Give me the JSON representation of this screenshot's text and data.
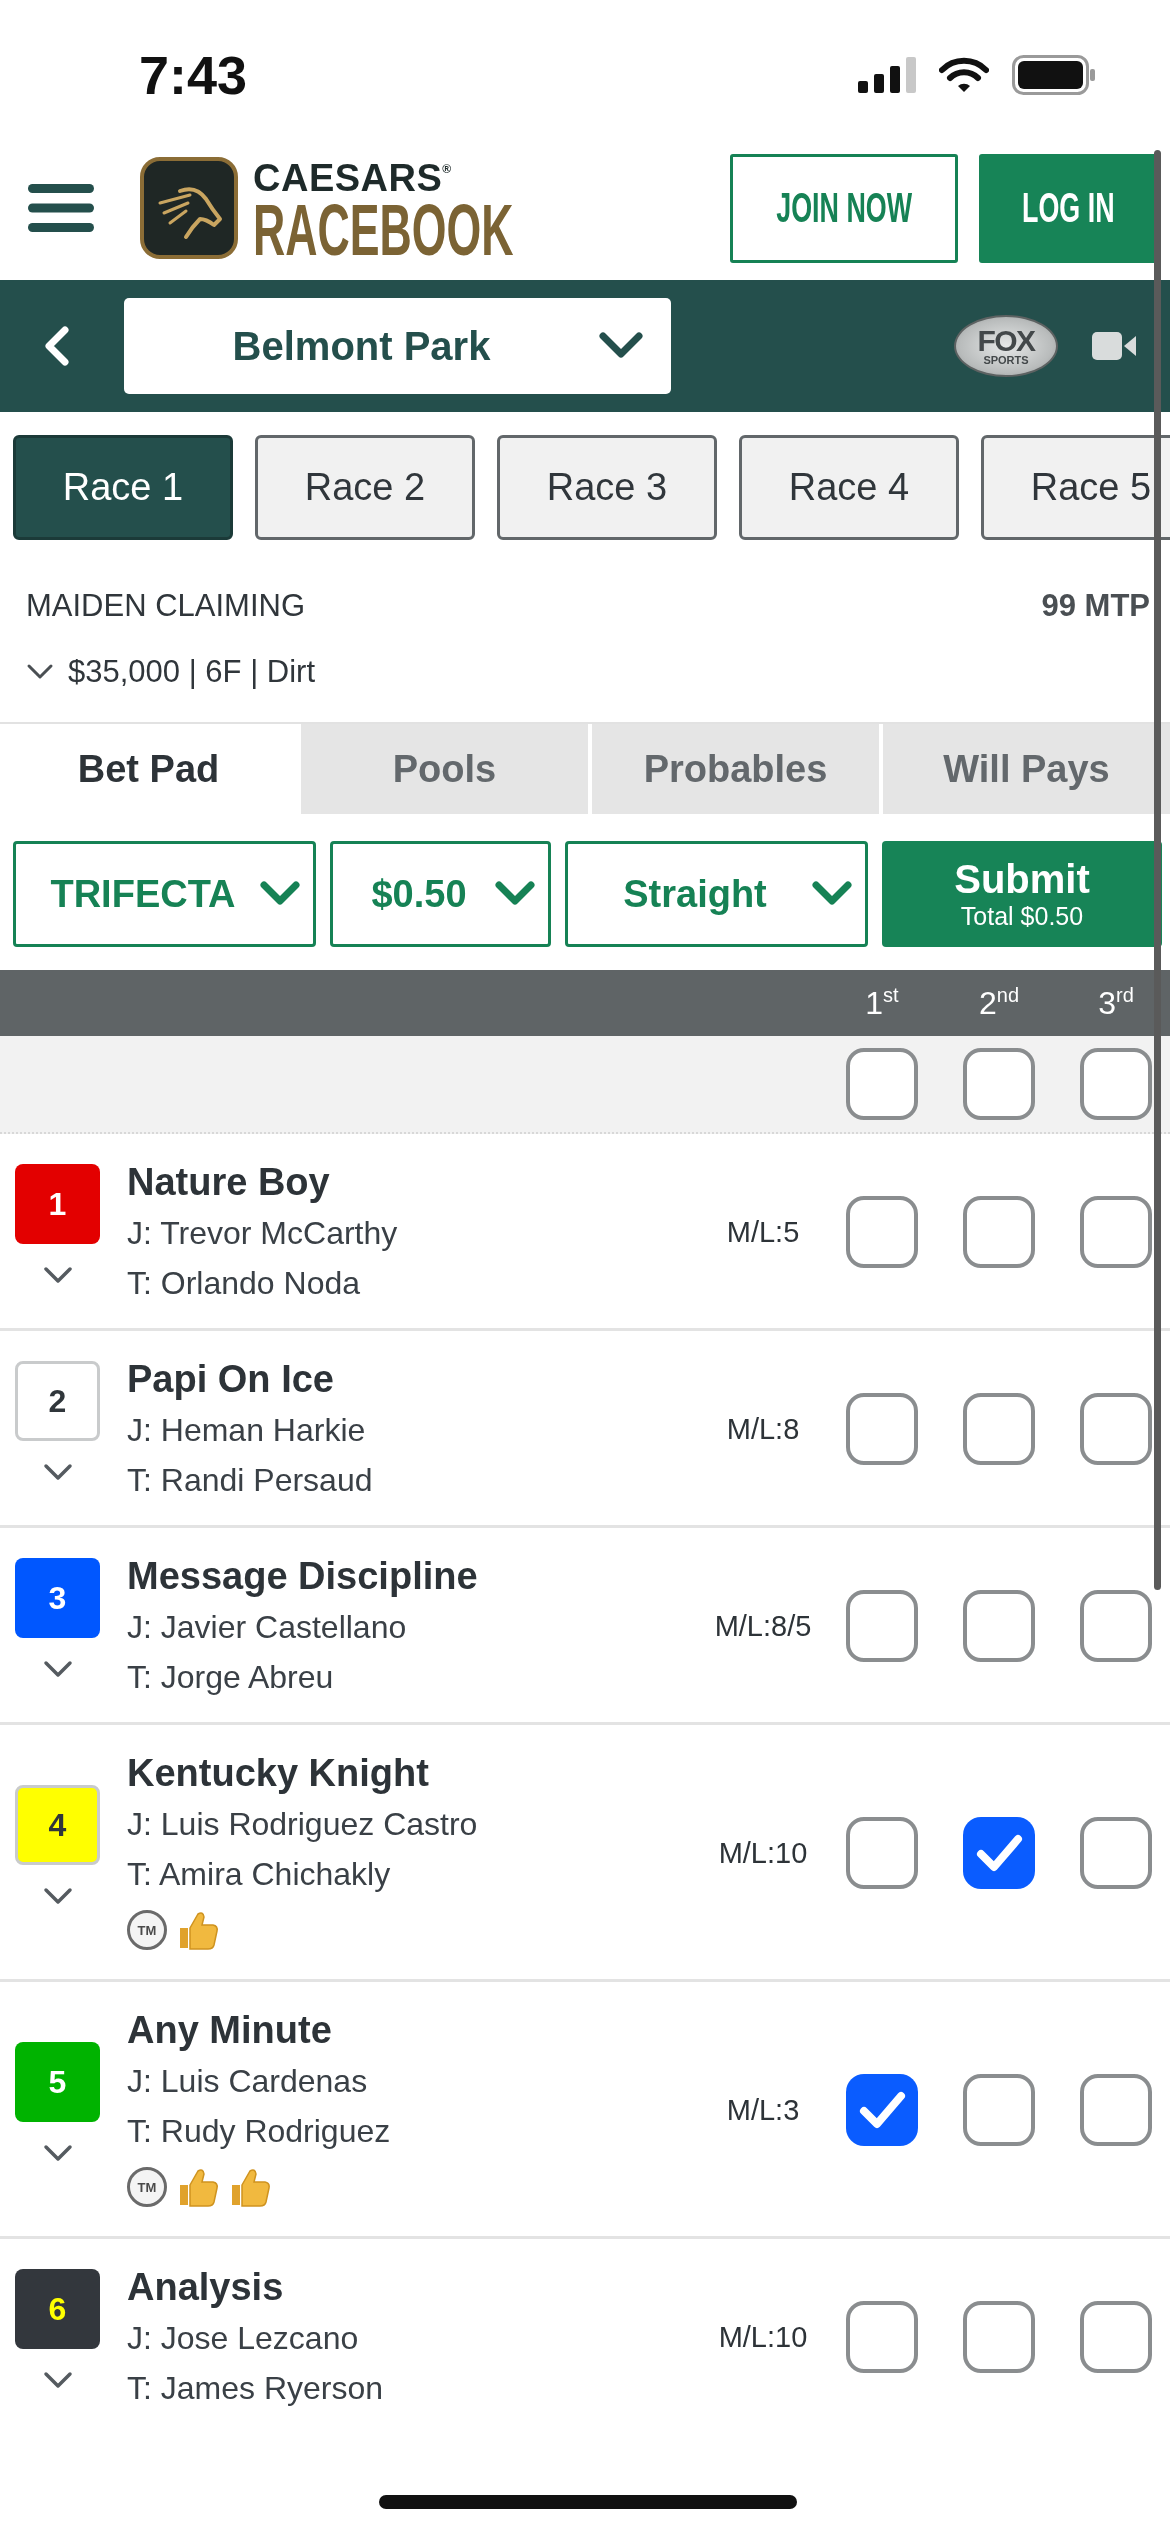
{
  "status_bar": {
    "time": "7:43"
  },
  "header": {
    "brand_top": "CAESARS$^{®}$",
    "brand_bottom": "RACEBOOK",
    "buttons": [
      {
        "label": "JOIN NOW",
        "kind": "outline"
      },
      {
        "label": "LOG IN",
        "kind": "filled"
      }
    ]
  },
  "track_bar": {
    "track": "Belmont Park",
    "channel_logo": {
      "top": "FOX",
      "bottom": "SPORTS"
    }
  },
  "race_tabs": [
    {
      "label": "Race 1",
      "selected": true
    },
    {
      "label": "Race 2",
      "selected": false
    },
    {
      "label": "Race 3",
      "selected": false
    },
    {
      "label": "Race 4",
      "selected": false
    },
    {
      "label": "Race 5",
      "selected": false
    }
  ],
  "race_info": {
    "race_type": "MAIDEN CLAIMING",
    "mtp": "99 MTP",
    "details": "$35,000 | 6F | Dirt"
  },
  "view_tabs": [
    {
      "label": "Bet Pad",
      "selected": true
    },
    {
      "label": "Pools",
      "selected": false
    },
    {
      "label": "Probables",
      "selected": false
    },
    {
      "label": "Will Pays",
      "selected": false
    }
  ],
  "bet_controls": {
    "dropdowns": [
      "TRIFECTA",
      "$0.50",
      "Straight"
    ],
    "submit": {
      "label": "Submit",
      "total": "Total $0.50"
    }
  },
  "positions": [
    {
      "label": "1$^{st}$",
      "checked": false
    },
    {
      "label": "2$^{nd}$",
      "checked": false
    },
    {
      "label": "3$^{rd}$",
      "checked": false
    }
  ],
  "runners": [
    {
      "number": {
        "text": "1",
        "color": "#ffffff"
      },
      "color": "#e30000",
      "outlined": false,
      "name": "Nature Boy",
      "jockey": "J: Trevor McCarthy",
      "trainer": "T: Orlando Noda",
      "odds": "M/L:5",
      "picks": [
        {
          "checked": false
        },
        {
          "checked": false
        },
        {
          "checked": false
        }
      ]
    },
    {
      "number": {
        "text": "2",
        "color": "#30363b"
      },
      "color": "#ffffff",
      "outlined": true,
      "name": "Papi On Ice",
      "jockey": "J: Heman Harkie",
      "trainer": "T: Randi Persaud",
      "odds": "M/L:8",
      "picks": [
        {
          "checked": false
        },
        {
          "checked": false
        },
        {
          "checked": false
        }
      ]
    },
    {
      "number": {
        "text": "3",
        "color": "#ffffff"
      },
      "color": "#0057ff",
      "outlined": false,
      "name": "Message Discipline",
      "jockey": "J: Javier Castellano",
      "trainer": "T: Jorge Abreu",
      "odds": "M/L:8/5",
      "picks": [
        {
          "checked": false
        },
        {
          "checked": false
        },
        {
          "checked": false
        }
      ]
    },
    {
      "number": {
        "text": "4",
        "color": "#30363b"
      },
      "color": "#ffff00",
      "outlined": true,
      "name": "Kentucky Knight",
      "jockey": "J: Luis Rodriguez Castro",
      "trainer": "T: Amira Chichakly",
      "odds": "M/L:10",
      "picks": [
        {
          "checked": false
        },
        {
          "checked": true
        },
        {
          "checked": false
        }
      ],
      "badges": [
        {
          "kind": "tm",
          "text": "TM"
        },
        {
          "kind": "thumbs_up"
        }
      ]
    },
    {
      "number": {
        "text": "5",
        "color": "#ffffff"
      },
      "color": "#00b300",
      "outlined": false,
      "name": "Any Minute",
      "jockey": "J: Luis Cardenas",
      "trainer": "T: Rudy Rodriguez",
      "odds": "M/L:3",
      "picks": [
        {
          "checked": true
        },
        {
          "checked": false
        },
        {
          "checked": false
        }
      ],
      "badges": [
        {
          "kind": "tm",
          "text": "TM"
        },
        {
          "kind": "thumbs_up"
        },
        {
          "kind": "thumbs_up"
        }
      ]
    },
    {
      "number": {
        "text": "6",
        "color": "#ffff00"
      },
      "color": "#33373d",
      "outlined": false,
      "name": "Analysis",
      "jockey": "J: Jose Lezcano",
      "trainer": "T: James Ryerson",
      "odds": "M/L:10",
      "picks": [
        {
          "checked": false
        },
        {
          "checked": false
        },
        {
          "checked": false
        }
      ]
    }
  ]
}
